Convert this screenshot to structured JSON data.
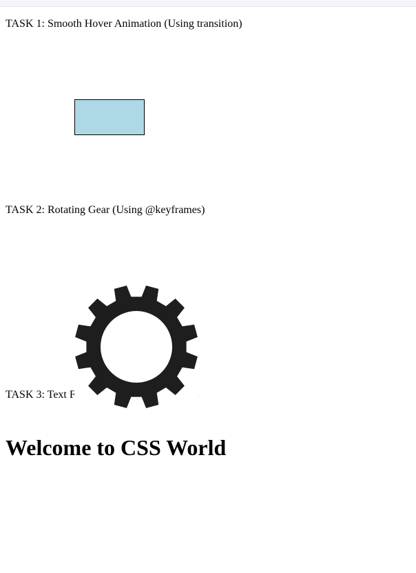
{
  "tasks": [
    {
      "label": "TASK 1: Smooth Hover Animation (Using transition)"
    },
    {
      "label": "TASK 2: Rotating Gear (Using @keyframes)"
    },
    {
      "label": "TASK 3: Text Fade-In (Using @keyframes)"
    }
  ],
  "hover_box": {
    "color": "#add8e6",
    "border_color": "#000000"
  },
  "gear": {
    "icon": "gear-icon",
    "color": "#1e1e1e"
  },
  "heading": {
    "text": "Welcome to CSS World"
  }
}
